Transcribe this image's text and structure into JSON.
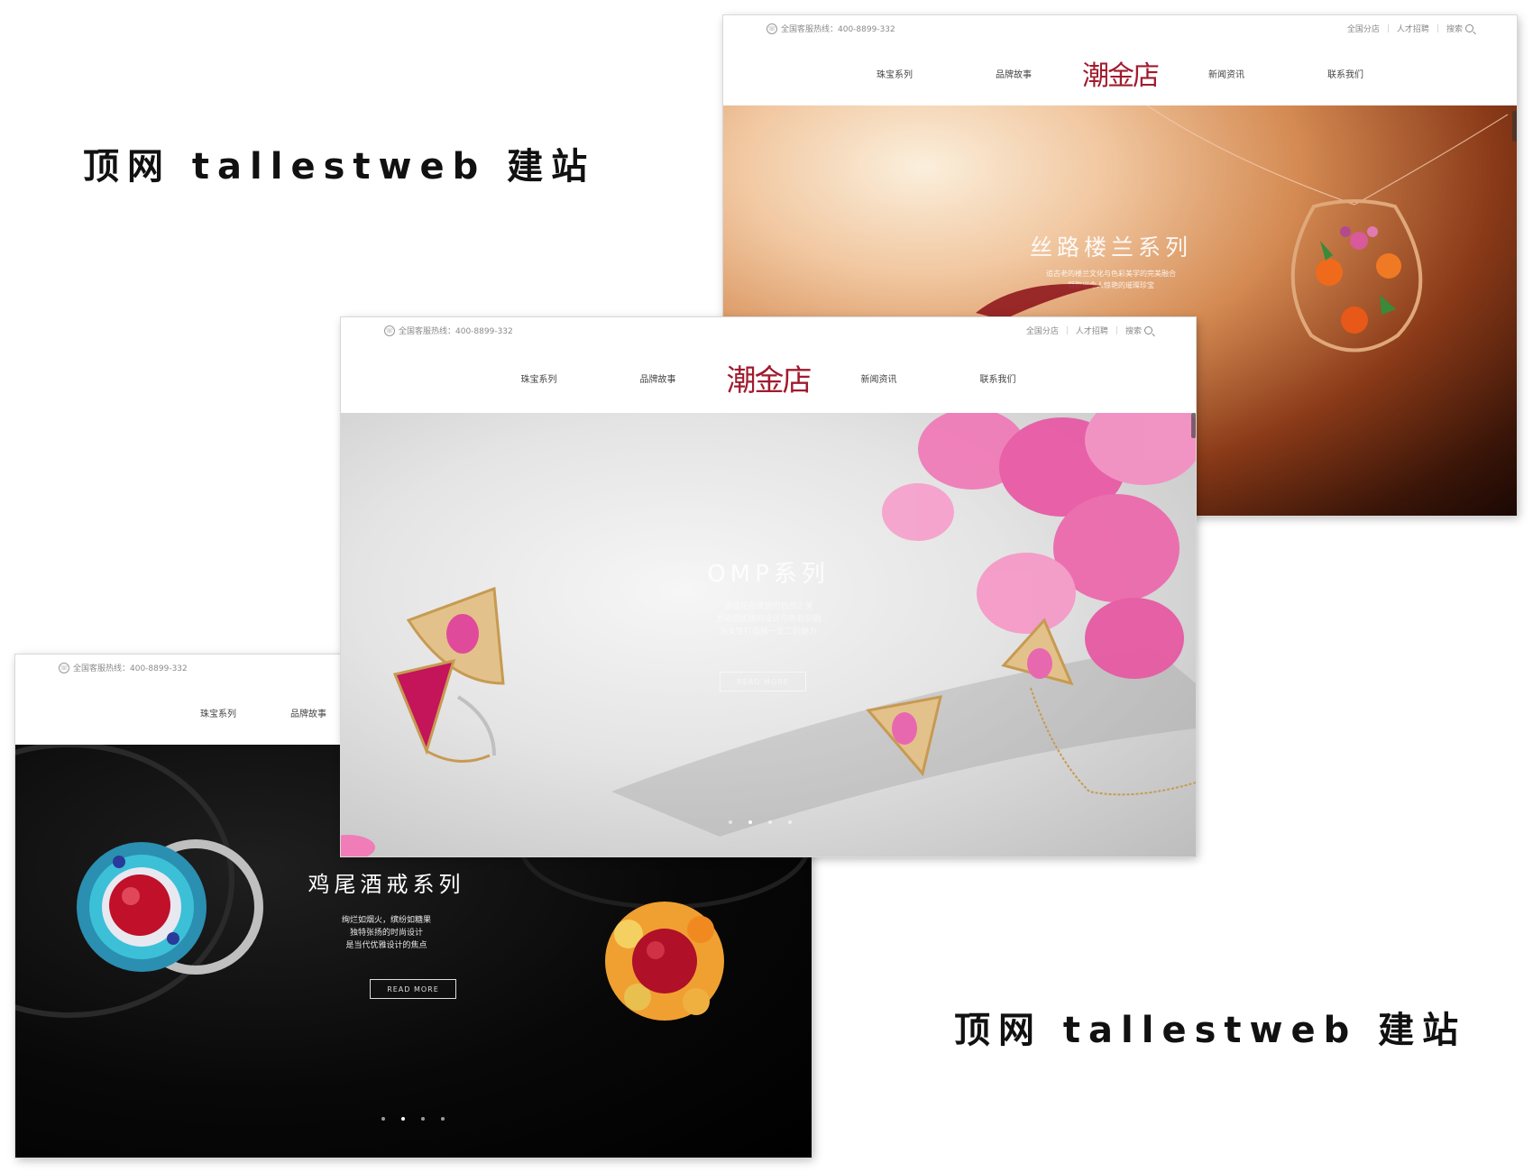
{
  "watermark": {
    "top": "顶网 tallestweb 建站",
    "bottom": "顶网 tallestweb 建站"
  },
  "site": {
    "hotline": "全国客服热线：400-8899-332",
    "utility": {
      "branches": "全国分店",
      "careers": "人才招聘",
      "search": "搜索"
    },
    "nav": {
      "jewelry": "珠宝系列",
      "brand_story": "品牌故事",
      "logo": "潮金店",
      "news": "新闻资讯",
      "contact": "联系我们"
    },
    "read_more": "READ MORE"
  },
  "shots": {
    "silk_road": {
      "title": "丝路楼兰系列",
      "desc": [
        "追古老的楼兰文化与色彩美学的完美融合",
        "撷取出令人惊艳的璀璨珍宝"
      ]
    },
    "omp": {
      "title": "OMP系列",
      "desc": [
        "源自花卉绽放的自然之美",
        "灵动而优雅的设计与色彩交融",
        "为女性打造独一无二的魅力"
      ]
    },
    "cocktail": {
      "title": "鸡尾酒戒系列",
      "desc": [
        "绚烂如烟火，缤纷如糖果",
        "独特张扬的时尚设计",
        "是当代优雅设计的焦点"
      ],
      "slides_count": 4,
      "active_slide": 2
    }
  },
  "colors": {
    "logo_red": "#a01b2e",
    "gold": "#d8b46a",
    "pink_gem": "#e04a9a",
    "ruby": "#c0102a",
    "turquoise": "#3cc0d8"
  },
  "icons": [
    "phone-icon",
    "search-icon"
  ]
}
